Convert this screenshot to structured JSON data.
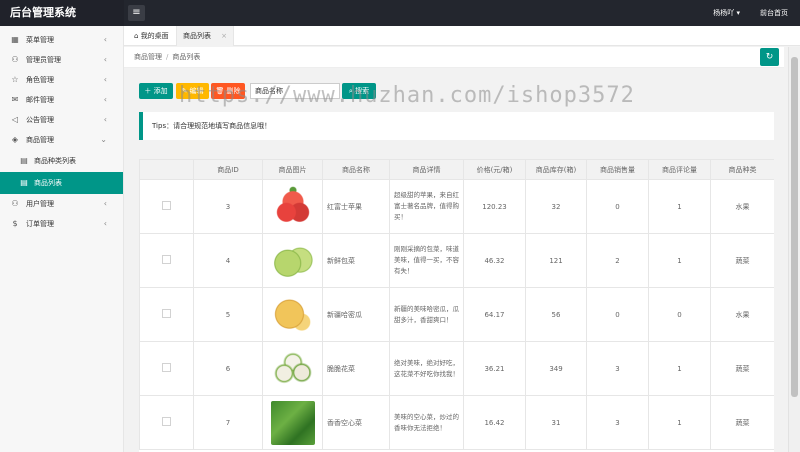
{
  "app": {
    "title": "后台管理系统",
    "menu_icon": "hamburger-icon"
  },
  "header": {
    "user": "杨杨吖",
    "home": "前台首页"
  },
  "sidebar": {
    "items": [
      {
        "label": "菜单管理",
        "icon": "grid-icon",
        "expanded": false
      },
      {
        "label": "管理员管理",
        "icon": "user-icon",
        "expanded": false
      },
      {
        "label": "角色管理",
        "icon": "star-icon",
        "expanded": false
      },
      {
        "label": "邮件管理",
        "icon": "mail-icon",
        "expanded": false
      },
      {
        "label": "公告管理",
        "icon": "speaker-icon",
        "expanded": false
      },
      {
        "label": "商品管理",
        "icon": "layers-icon",
        "expanded": true
      },
      {
        "label": "商品种类列表",
        "icon": "doc-icon",
        "sub": true
      },
      {
        "label": "商品列表",
        "icon": "doc-icon",
        "sub": true,
        "active": true
      },
      {
        "label": "用户管理",
        "icon": "user-icon",
        "expanded": false
      },
      {
        "label": "订单管理",
        "icon": "dollar-icon",
        "expanded": false
      }
    ]
  },
  "tabs": [
    {
      "label": "我的桌面",
      "icon": "home-icon"
    },
    {
      "label": "商品列表",
      "active": true
    }
  ],
  "breadcrumb": {
    "parent": "商品管理",
    "separator": "/",
    "current": "商品列表"
  },
  "toolbar": {
    "add": "＋ 添加",
    "edit": "✎ 编辑",
    "delete": "🗑 删除",
    "search_value": "商品名称",
    "search": "⌕ 搜索"
  },
  "watermark": "https://www.huzhan.com/ishop3572",
  "tips": "Tips：请合理规范地填写商品信息哦！",
  "table": {
    "headers": [
      "",
      "商品ID",
      "商品图片",
      "商品名称",
      "商品详情",
      "价格(元/箱)",
      "商品库存(箱)",
      "商品销售量",
      "商品评论量",
      "商品种类"
    ],
    "rows": [
      {
        "id": "3",
        "img": "apple",
        "name": "红富士苹果",
        "desc": "超级甜的苹果，来自红富士著名品牌，值得购买！",
        "price": "120.23",
        "stock": "32",
        "sales": "0",
        "reviews": "1",
        "kind": "水果"
      },
      {
        "id": "4",
        "img": "cabbage",
        "name": "新鲜包菜",
        "desc": "刚刚采摘的包菜，味道美味，值得一买，不容有失！",
        "price": "46.32",
        "stock": "121",
        "sales": "2",
        "reviews": "1",
        "kind": "蔬菜"
      },
      {
        "id": "5",
        "img": "melon",
        "name": "新疆哈密瓜",
        "desc": "新疆的美味哈密瓜，瓜甜多汁，香甜爽口！",
        "price": "64.17",
        "stock": "56",
        "sales": "0",
        "reviews": "0",
        "kind": "水果"
      },
      {
        "id": "6",
        "img": "cauliflower",
        "name": "脆脆花菜",
        "desc": "绝对美味，绝对好吃，这花菜不好吃你找我！",
        "price": "36.21",
        "stock": "349",
        "sales": "3",
        "reviews": "1",
        "kind": "蔬菜"
      },
      {
        "id": "7",
        "img": "spinach",
        "name": "香香空心菜",
        "desc": "美味的空心菜，炒过的香味你无法拒绝！",
        "price": "16.42",
        "stock": "31",
        "sales": "3",
        "reviews": "1",
        "kind": "蔬菜"
      }
    ]
  }
}
